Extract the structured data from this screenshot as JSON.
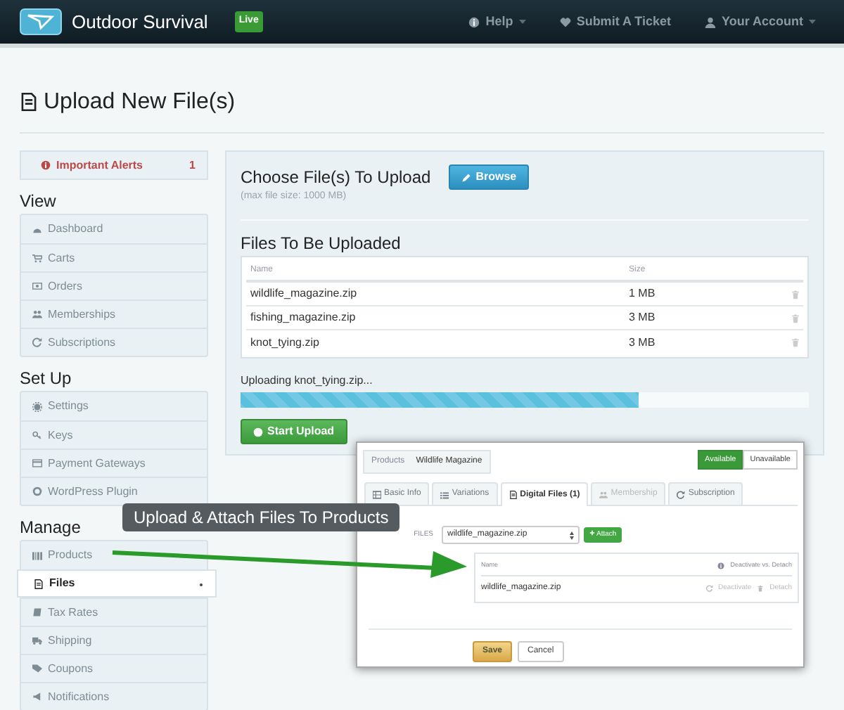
{
  "navbar": {
    "brand": "Outdoor Survival",
    "badge": "Live",
    "links": [
      {
        "label": "Help",
        "dropdown": true
      },
      {
        "label": "Submit A Ticket",
        "dropdown": false
      },
      {
        "label": "Your Account",
        "dropdown": true
      }
    ]
  },
  "page_title": "Upload New File(s)",
  "sidebar": {
    "alert": {
      "label": "Important Alerts",
      "count": "1"
    },
    "sections": [
      {
        "heading": "View",
        "items": [
          {
            "label": "Dashboard",
            "selected": false
          },
          {
            "label": "Carts",
            "selected": false
          },
          {
            "label": "Orders",
            "selected": false
          },
          {
            "label": "Memberships",
            "selected": false
          },
          {
            "label": "Subscriptions",
            "selected": false
          }
        ]
      },
      {
        "heading": "Set Up",
        "items": [
          {
            "label": "Settings",
            "selected": false
          },
          {
            "label": "Keys",
            "selected": false
          },
          {
            "label": "Payment Gateways",
            "selected": false
          },
          {
            "label": "WordPress Plugin",
            "selected": false
          }
        ]
      },
      {
        "heading": "Manage",
        "items": [
          {
            "label": "Products",
            "selected": false
          },
          {
            "label": "Files",
            "selected": true
          },
          {
            "label": "Tax Rates",
            "selected": false
          },
          {
            "label": "Shipping",
            "selected": false
          },
          {
            "label": "Coupons",
            "selected": false
          },
          {
            "label": "Notifications",
            "selected": false
          }
        ]
      }
    ]
  },
  "upload": {
    "title": "Choose File(s) To Upload",
    "browse": "Browse",
    "hint": "(max file size: 1000 MB)",
    "files_title": "Files To Be Uploaded",
    "columns": [
      "Name",
      "Size"
    ],
    "rows": [
      {
        "name": "wildlife_magazine.zip",
        "size": "1 MB"
      },
      {
        "name": "fishing_magazine.zip",
        "size": "3 MB"
      },
      {
        "name": "knot_tying.zip",
        "size": "3 MB"
      }
    ],
    "status": "Uploading knot_tying.zip...",
    "level": 0.7,
    "start": "Start Upload"
  },
  "callout": "Upload & Attach Files To Products",
  "preview": {
    "breadcrumb": [
      "Products",
      "Wildlife Magazine"
    ],
    "availability": [
      {
        "label": "Available",
        "selected": true
      },
      {
        "label": "Unavailable",
        "selected": false
      }
    ],
    "tabs": [
      {
        "label": "Basic Info",
        "selected": false,
        "disabled": false
      },
      {
        "label": "Variations",
        "selected": false,
        "disabled": false
      },
      {
        "label": "Digital Files (1)",
        "selected": true,
        "disabled": false
      },
      {
        "label": "Membership",
        "selected": false,
        "disabled": true
      },
      {
        "label": "Subscription",
        "selected": false,
        "disabled": false
      }
    ],
    "files_label": "FILES",
    "select_value": "wildlife_magazine.zip",
    "attach": "Attach",
    "column": "Name",
    "help": "Deactivate vs. Detach",
    "rows": [
      {
        "name": "wildlife_magazine.zip",
        "actions": [
          "Deactivate",
          "Detach"
        ]
      }
    ],
    "save": "Save",
    "cancel": "Cancel"
  }
}
